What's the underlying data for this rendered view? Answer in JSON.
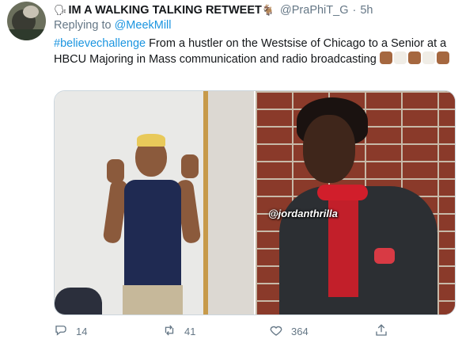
{
  "author": {
    "name": "IM A WALKING TALKING RETWEET",
    "name_prefix_emoji": "🗣",
    "name_suffix_emoji": "🐐",
    "handle": "@PraPhiT_G",
    "separator": "·",
    "time": "5h"
  },
  "reply": {
    "prefix": "Replying to",
    "mention": "@MeekMill"
  },
  "body": {
    "hashtag": "#believechallenge",
    "text": " From a hustler on the Westsise of Chicago to a Senior at a HBCU Majoring in Mass communication and radio broadcasting ",
    "emoji_colors": [
      "#a5673f",
      "#ffffff",
      "#a5673f",
      "#ffffff",
      "#a5673f"
    ]
  },
  "media": {
    "left_photo": "shirtless-tank-top-photo",
    "right_photo": "suit-red-bowtie-photo",
    "watermark": "@jordanthrilla"
  },
  "actions": {
    "reply_count": "14",
    "retweet_count": "41",
    "like_count": "364"
  },
  "colors": {
    "link": "#1b95e0",
    "meta": "#657786"
  }
}
